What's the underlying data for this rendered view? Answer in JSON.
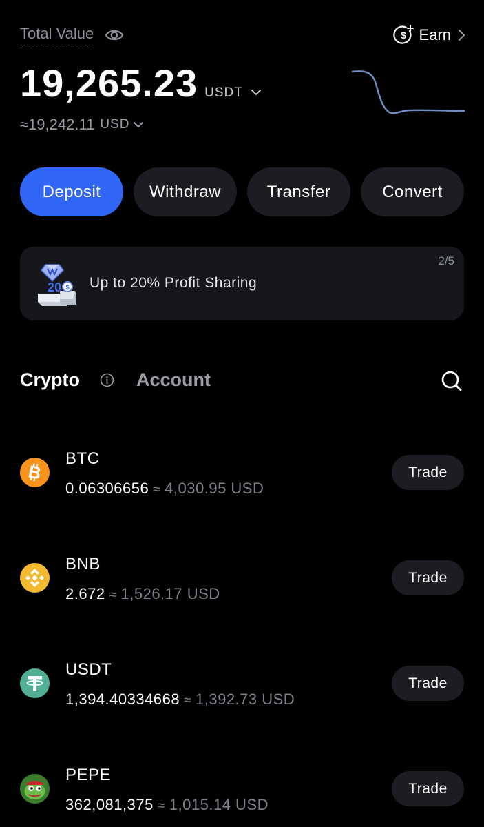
{
  "header": {
    "total_value_label": "Total Value",
    "earn_label": "Earn",
    "balance": "19,265.23",
    "balance_unit": "USDT",
    "approx_value": "≈19,242.11",
    "approx_unit": "USD"
  },
  "actions": {
    "deposit": "Deposit",
    "withdraw": "Withdraw",
    "transfer": "Transfer",
    "convert": "Convert"
  },
  "banner": {
    "text": "Up to 20% Profit Sharing",
    "page_indicator": "2/5",
    "art_text": "20"
  },
  "tabs": {
    "crypto": "Crypto",
    "account": "Account"
  },
  "assets": [
    {
      "symbol": "BTC",
      "amount": "0.06306656",
      "approx": "≈",
      "fiat": "4,030.95 USD",
      "trade": "Trade",
      "icon": "btc-icon",
      "color": "#f7931a"
    },
    {
      "symbol": "BNB",
      "amount": "2.672",
      "approx": "≈",
      "fiat": "1,526.17 USD",
      "trade": "Trade",
      "icon": "bnb-icon",
      "color": "#f3ba2f"
    },
    {
      "symbol": "USDT",
      "amount": "1,394.40334668",
      "approx": "≈",
      "fiat": "1,392.73 USD",
      "trade": "Trade",
      "icon": "usdt-icon",
      "color": "#50af95"
    },
    {
      "symbol": "PEPE",
      "amount": "362,081,375",
      "approx": "≈",
      "fiat": "1,015.14 USD",
      "trade": "Trade",
      "icon": "pepe-icon",
      "color": "#4c8f3a"
    }
  ],
  "colors": {
    "background": "#000000",
    "primary_button": "#2f66f6",
    "secondary_button": "#1c1d22",
    "sparkline": "#6f8fc4"
  }
}
